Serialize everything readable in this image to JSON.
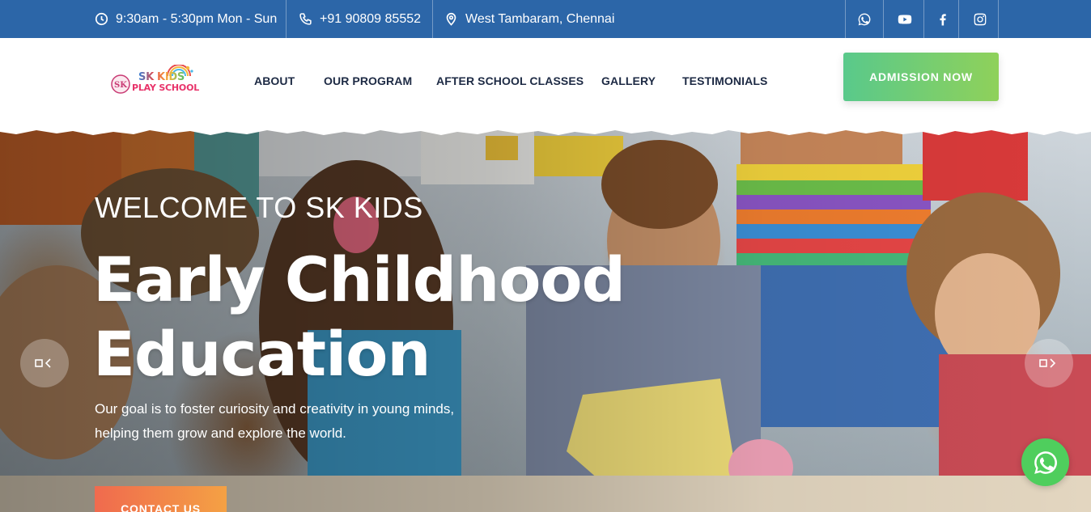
{
  "topbar": {
    "hours": "9:30am - 5:30pm Mon - Sun",
    "phone": "+91 90809 85552",
    "address": "West Tambaram, Chennai",
    "hours_icon": "clock-icon",
    "phone_icon": "phone-icon",
    "address_icon": "map-pin-icon",
    "social": [
      "whatsapp-icon",
      "youtube-icon",
      "facebook-icon",
      "instagram-icon"
    ],
    "background": "#2c66a8"
  },
  "logo": {
    "line1": "SK KIDS",
    "line2": "PLAY SCHOOL"
  },
  "nav": {
    "items": [
      "ABOUT",
      "OUR PROGRAM",
      "AFTER SCHOOL CLASSES",
      "GALLERY",
      "TESTIMONIALS"
    ],
    "color": "#1d2a44"
  },
  "header": {
    "cta": "ADMISSION NOW",
    "cta_colors": [
      "#59c98b",
      "#8fd15a"
    ]
  },
  "hero": {
    "welcome": "WELCOME TO SK KIDS",
    "headline_line1": "Early Childhood",
    "headline_line2": "Education",
    "description_line1": "Our goal is to foster curiosity and creativity in young minds,",
    "description_line2": "helping them grow and explore the world.",
    "cta": "CONTACT US",
    "cta_colors": [
      "#f06a4e",
      "#f4a144"
    ],
    "prev_icon": "chevron-left-icon",
    "next_icon": "chevron-right-icon"
  },
  "float": {
    "icon": "whatsapp-icon",
    "color": "#4fce5d"
  }
}
